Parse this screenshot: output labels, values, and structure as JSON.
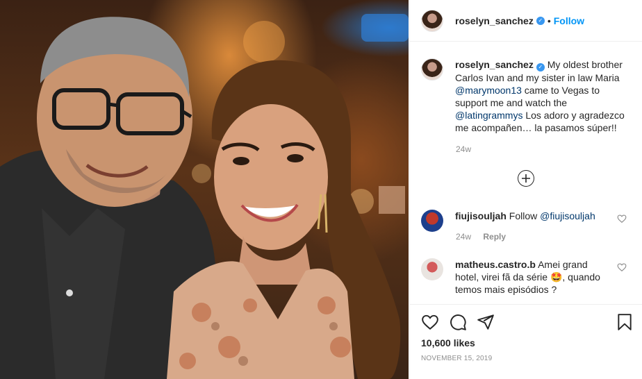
{
  "post": {
    "username": "roselyn_sanchez",
    "follow_label": "Follow",
    "dot": "•",
    "verified_glyph": "✓"
  },
  "caption": {
    "username": "roselyn_sanchez",
    "text_1": "My oldest brother Carlos Ivan and my sister in law Maria ",
    "mention_1": "@marymoon13",
    "text_2": " came to Vegas to support me and watch the ",
    "mention_2": "@latingrammys",
    "text_3": " Los adoro y agradezco me acompañen… la pasamos súper!!",
    "time": "24w"
  },
  "comments": [
    {
      "username": "fiujisouljah",
      "text": "Follow ",
      "mention": "@fiujisouljah",
      "time": "24w",
      "reply_label": "Reply"
    },
    {
      "username": "matheus.castro.b",
      "text_1": "Amei grand hotel, virei fã da série ",
      "emoji": "🤩",
      "text_2": ", quando temos mais episódios ?"
    }
  ],
  "footer": {
    "likes": "10,600 likes",
    "date": "NOVEMBER 15, 2019"
  },
  "icons": {
    "heart": "heart-icon",
    "comment": "comment-icon",
    "share": "share-icon",
    "save": "bookmark-icon",
    "more": "plus-circle-icon"
  },
  "colors": {
    "link": "#00376b",
    "follow": "#0095f6",
    "verified": "#3897f0",
    "muted": "#8e8e8e",
    "text": "#262626"
  }
}
